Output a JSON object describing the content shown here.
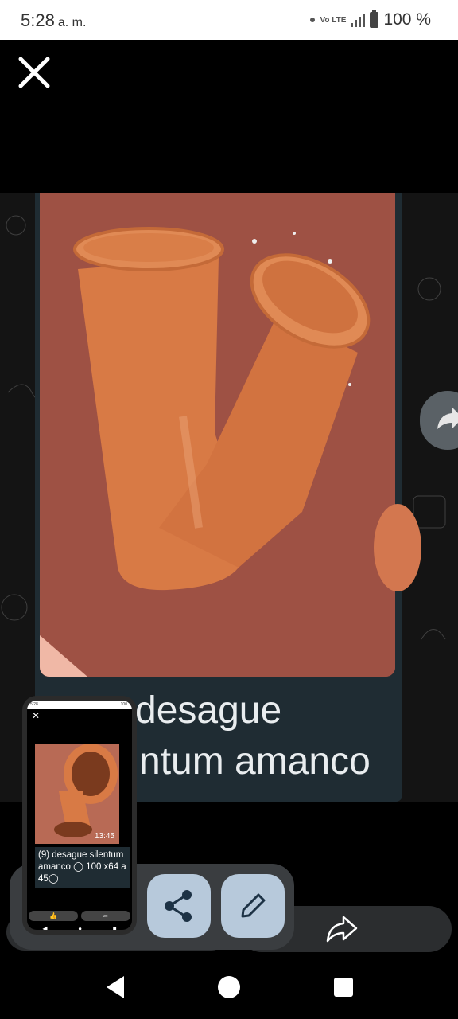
{
  "status_bar": {
    "time": "5:28",
    "ampm": "a. m.",
    "network": "Vo LTE",
    "battery": "100 %"
  },
  "viewer": {
    "caption_lines": [
      "desague",
      "ntum amanco"
    ],
    "icons": {
      "close": "close-icon",
      "forward_side": "forward-icon"
    }
  },
  "pip": {
    "time": "13:45",
    "caption": "(9)  desague silentum amanco ◯ 100 x64 a 45◯"
  },
  "actions": {
    "share_icon": "share-icon",
    "edit_icon": "pencil-icon",
    "forward_icon": "forward-icon"
  },
  "colors": {
    "fab": "#b7c9db",
    "pipe": "#d87a45",
    "photo_bg": "#a5574a"
  }
}
